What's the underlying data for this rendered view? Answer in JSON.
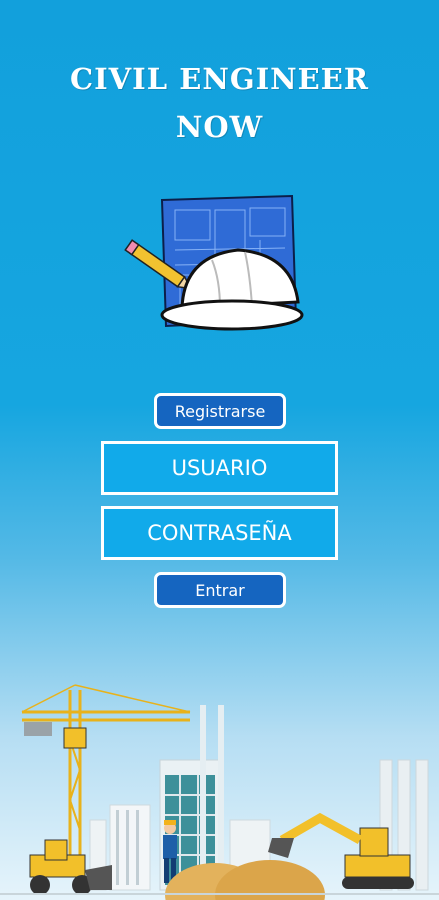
{
  "app": {
    "title_line1": "CIVIL ENGINEER",
    "title_line2": "NOW"
  },
  "logo_icon": "blueprint-pencil-hardhat-icon",
  "register_button": {
    "label": "Registrarse"
  },
  "username_field": {
    "placeholder": "USUARIO"
  },
  "password_field": {
    "placeholder": "CONTRASEÑA"
  },
  "login_button": {
    "label": "Entrar"
  },
  "scene_icon": "construction-site-illustration",
  "colors": {
    "background": "#12a0dc",
    "button": "#1565c0",
    "field": "#11aaea"
  }
}
